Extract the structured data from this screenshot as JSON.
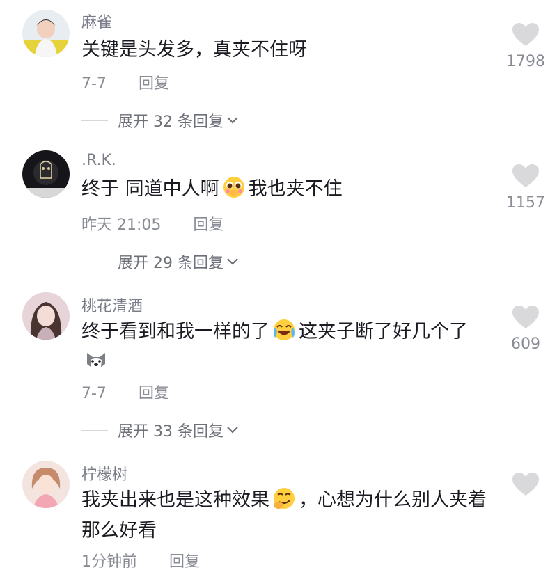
{
  "comments": [
    {
      "username": "麻雀",
      "text": "关键是头发多，真夹不住呀",
      "date": "7-7",
      "reply_label": "回复",
      "likes": "1798",
      "expand_label": "展开 32 条回复"
    },
    {
      "username": ".R.K.",
      "text_a": "终于 同道中人啊",
      "text_b": "我也夹不住",
      "date": "昨天 21:05",
      "reply_label": "回复",
      "likes": "1157",
      "expand_label": "展开 29 条回复"
    },
    {
      "username": "桃花清酒",
      "text_a": "终于看到和我一样的了",
      "text_b": "这夹子断了好几个了",
      "date": "7-7",
      "reply_label": "回复",
      "likes": "609",
      "expand_label": "展开 33 条回复"
    },
    {
      "username": "柠檬树",
      "text_a": "我夹出来也是这种效果",
      "text_b": "，心想为什么别人夹着那么好看",
      "date": "1分钟前",
      "reply_label": "回复",
      "likes": ""
    }
  ],
  "colors": {
    "heart": "#d9d9dc",
    "meta": "#8a8c95",
    "username": "#7a7d88"
  },
  "icons": [
    "heart-icon",
    "chevron-down-icon",
    "pleading-face-emoji",
    "crying-laughing-emoji",
    "husky-dog-emoji",
    "smirking-face-emoji"
  ]
}
